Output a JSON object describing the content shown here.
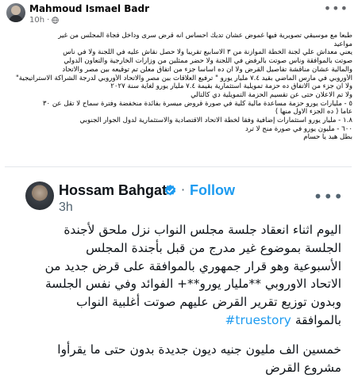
{
  "post": {
    "author": "Mahmoud Ismael Badr",
    "time": "10h",
    "privacy_icon": "globe-icon",
    "more_icon": "more-dots-icon",
    "lines": [
      "طبعا مع موسيقي تصويرية فيها غموض عشان تديك احساس انه قرض سرى وداخل فجأة المجلس من غير",
      "مواعيد",
      "يعني معداش علي لجنة الخطة الموازنة من ٣ الاسابيع تقريبا ولا حصل نقاش عليه في اللجنة ولا في ناس",
      "صوتت بالموافقة وناس صوتت بالرفض في اللجنة ولا حضر ممثلين من وزارات الخارجية والتعاون الدولي",
      "والمالية عشان مناقشة تفاصيل القرض ولا ان ده اساسا جزء من اتفاق معلن تم توقيعه بين مصر والاتحاد",
      "الأوروبي في مارس الماضي بقيد ٧.٤ مليار يورو \" ترفيع العلاقات بين مصر والاتحاد الأوروبي لدرجة الشراكة الاستراتيجية\"",
      "ولا ان جزء من الاتفاق ده حزمة تمويلية استثمارية بقيمة ٧.٤ مليار يورو لغاية سنة ٢٠٢٧",
      "ولا تم الاعلان حتى عن تقسيم الحزمة التمويلية دي كالتالي",
      "٥ - مليارات يورو حزمة مساعدة مالية كلية في صورة قروض ميسرة بفائدة منخفضة وفترة سماح لا تقل عن ٣٠",
      "عاما ( ده الجزء الاول منها )",
      "١.٨ - مليار يورو استثمارات إضافية وفقا لخطة الاتحاد الاقتصادية والاستثمارية لدول الجوار الجنوبي",
      "٦٠٠ - مليون يورو في صورة منح لا ترد",
      "بطل هبد يا حسام"
    ]
  },
  "tweet": {
    "author": "Hossam Bahgat",
    "verified_icon": "verified-badge-icon",
    "separator": "·",
    "follow_label": "Follow",
    "time": "3h",
    "more_icon": "more-dots-icon",
    "lines": [
      "اليوم اثناء انعقاد جلسة مجلس النواب نزل ملحق لأجندة",
      "الجلسة بموضوع غير مدرج من قبل بأجندة المجلس",
      "الأسبوعية وهو قرار جمهوري بالموافقة على قرض جديد من",
      "الاتحاد الاوروبي **مليار يورو**+ الفوائد وفي نفس الجلسة",
      "وبدون توزيع تقرير القرض عليهم صوتت أغلبية النواب"
    ],
    "last_line_text": "بالموافقة",
    "hashtag": "#truestory",
    "lines2": [
      "خمسين الف مليون جنيه ديون جديدة بدون حتى ما يقرأوا",
      "مشروع القرض"
    ]
  },
  "colors": {
    "link_blue": "#1d9bf0",
    "secondary_text": "#65676b"
  }
}
